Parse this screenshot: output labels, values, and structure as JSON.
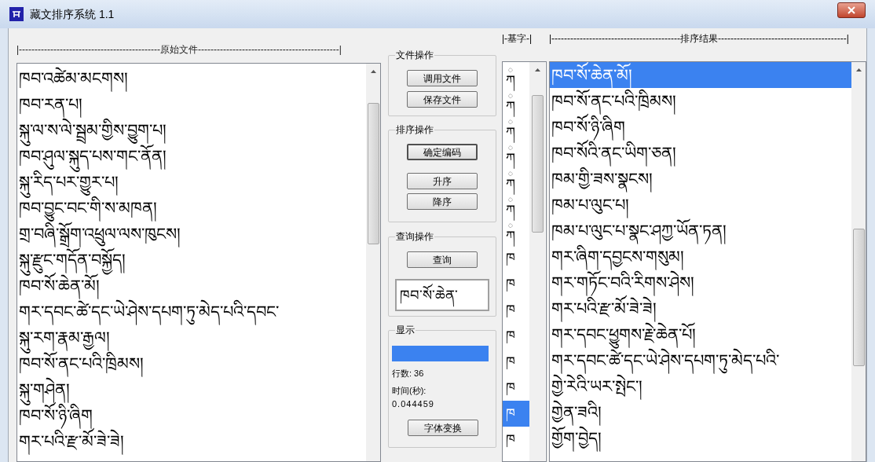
{
  "window": {
    "title": "藏文排序系统 1.1"
  },
  "original_file": {
    "header": "|---------------------------------------------原始文件---------------------------------------------|",
    "lines": [
      "ཁབ་འཚེམ་མངགས།",
      "ཁབ་རན་པ།",
      "སྐུ་ལ་ས་ལེ་སྦྲམ་གྱིས་བྱུག་པ།",
      "ཁབ་ཤུལ་སྐུད་པས་གང་ནོན།",
      "སྐུ་རིད་པར་གྱུར་པ།",
      "ཁབ་བྱུང་བང་གི་ས་མཁན།",
      "གྲ་བཞི་སྒྲོག་འཕྲུལ་ལས་ཁུངས།",
      "སྐུ་རྫུང་གདོན་བསྐྱོད།",
      "ཁབ་སོ་ཆེན་མོ།",
      "གར་དབང་ཚེ་དང་ཡེ་ཤེས་དཔག་ཏུ་མེད་པའི་དབང་",
      "སྐུ་རག་རྣམ་རྒྱལ།",
      "ཁབ་སོ་ནང་པའི་ཁྲིམས།",
      "སྐུ་གཤེན།",
      "ཁབ་སོ་ཉི་ཞིག",
      "གར་པའི་རྫ་མོ་ཟེ་ཟེ།"
    ]
  },
  "file_ops": {
    "title": "文件操作",
    "buttons": [
      {
        "label": "调用文件",
        "default": false
      },
      {
        "label": "保存文件",
        "default": false
      }
    ]
  },
  "sort_ops": {
    "title": "排序操作",
    "buttons": [
      {
        "label": "确定编码",
        "default": true
      },
      {
        "label": "升序",
        "default": false
      },
      {
        "label": "降序",
        "default": false
      }
    ]
  },
  "query_ops": {
    "title": "查询操作",
    "button": "查询",
    "query_value": "ཁབ་སོ་ཆེན་"
  },
  "display": {
    "title": "显示",
    "progress": {
      "level": 1
    },
    "line_count": "行数: 36",
    "time_label": "时间(秒):",
    "time_value": "0.044459",
    "button": "字体变换"
  },
  "base_letters": {
    "header": "|-基字-|",
    "items": [
      {
        "above": "◌",
        "letter": "ཀ",
        "selected": false
      },
      {
        "above": "◌",
        "letter": "ཀ",
        "selected": false
      },
      {
        "above": "◌",
        "letter": "ཀ",
        "selected": false
      },
      {
        "above": "◌",
        "letter": "ཀ",
        "selected": false
      },
      {
        "above": "◌",
        "letter": "ཀ",
        "selected": false
      },
      {
        "above": "◌",
        "letter": "ཀ",
        "selected": false
      },
      {
        "above": "◌",
        "letter": "ཀ",
        "selected": false
      },
      {
        "letter": "ཁ",
        "selected": false
      },
      {
        "letter": "ཁ",
        "selected": false
      },
      {
        "letter": "ཁ",
        "selected": false
      },
      {
        "letter": "ཁ",
        "selected": false
      },
      {
        "letter": "ཁ",
        "selected": false
      },
      {
        "letter": "ཁ",
        "selected": false
      },
      {
        "letter": "ཁ",
        "selected": true
      },
      {
        "letter": "ཁ",
        "selected": false
      }
    ]
  },
  "sort_result": {
    "header": "|-----------------------------------------排序结果-----------------------------------------|",
    "rows": [
      {
        "text": "ཁབ་སོ་ཆེན་མོ།",
        "selected": true
      },
      {
        "text": "ཁབ་སོ་ནང་པའི་ཁྲིམས།",
        "selected": false
      },
      {
        "text": "ཁབ་སོ་ཉི་ཞིག",
        "selected": false
      },
      {
        "text": "ཁབ་སོའི་ནང་ཡིག་ཅན།",
        "selected": false
      },
      {
        "text": "ཁམ་གྱི་ཟས་སྣངས།",
        "selected": false
      },
      {
        "text": "ཁམ་པ་ལུང་པ།",
        "selected": false
      },
      {
        "text": "ཁམ་པ་ལུང་པ་སྣང་ཤཀྱ་ཡོན་ཏན།",
        "selected": false
      },
      {
        "text": "གར་ཞིག་དབྱངས་གསུམ།",
        "selected": false
      },
      {
        "text": "གར་གཏོང་བའི་རིགས་ཤེས།",
        "selected": false
      },
      {
        "text": "གར་པའི་རྫ་མོ་ཟེ་ཟེ།",
        "selected": false
      },
      {
        "text": "གར་དབང་ཕྱུགས་རྗེ་ཆེན་པོ།",
        "selected": false
      },
      {
        "text": "གར་དབང་ཚེ་དང་ཡེ་ཤེས་དཔག་ཏུ་མེད་པའི་",
        "selected": false
      },
      {
        "text": "གྱེ་རེའི་ཡར་སྤེང་།",
        "selected": false
      },
      {
        "text": "གྱེན་ཟའི།",
        "selected": false
      },
      {
        "text": "གྱོག་བྱེད།",
        "selected": false
      }
    ]
  }
}
